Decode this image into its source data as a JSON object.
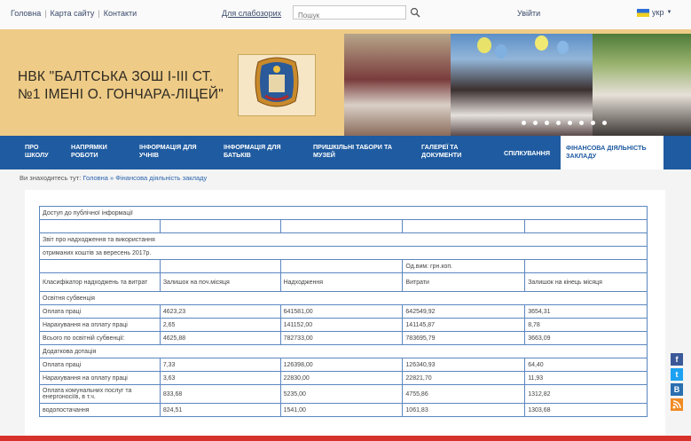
{
  "topbar": {
    "links": [
      "Головна",
      "Карта сайту",
      "Контакти"
    ],
    "vision_label": "Для слабозорих",
    "search_placeholder": "Пошук",
    "login_label": "Увійти",
    "lang_label": "укр"
  },
  "header": {
    "title": "НВК \"БАЛТСЬКА ЗОШ І-ІІІ СТ. №1 ІМЕНІ О. ГОНЧАРА-ЛІЦЕЙ\""
  },
  "nav": {
    "items": [
      "ПРО ШКОЛУ",
      "НАПРЯМКИ РОБОТИ",
      "ІНФОРМАЦІЯ ДЛЯ УЧНІВ",
      "ІНФОРМАЦІЯ ДЛЯ БАТЬКІВ",
      "ПРИШКІЛЬНІ ТАБОРИ ТА МУЗЕЙ",
      "ГАЛЕРЕЇ ТА ДОКУМЕНТИ",
      "СПІЛКУВАННЯ",
      "ФІНАНСОВА ДІЯЛЬНІСТЬ ЗАКЛАДУ"
    ],
    "active_index": 7
  },
  "breadcrumb": {
    "prefix": "Ви знаходитесь тут:",
    "home": "Головна",
    "separator": "»",
    "current": "Фінансова діяльність закладу"
  },
  "table": {
    "intro_rows": [
      "Доступ до публічної інформації",
      "Звіт про надходження та використання",
      "отриманих коштів за вересень 2017р."
    ],
    "units_note": "Од.вим: грн.коп.",
    "headers": [
      "Класифікатор надходжень та витрат",
      "Залишок на поч.місяця",
      "Надходження",
      "Витрати",
      "Залишок на кінець місяця"
    ],
    "rows": [
      {
        "section": "Освітня субвенція"
      },
      {
        "cells": [
          "Оплата праці",
          "4623,23",
          "641581,00",
          "642549,92",
          "3654,31"
        ]
      },
      {
        "cells": [
          "Нарахування на оплату праці",
          "2,65",
          "141152,00",
          "141145,87",
          "8,78"
        ]
      },
      {
        "cells": [
          "Всього по освітній субвенції:",
          "4625,88",
          "782733,00",
          "783695,79",
          "3663,09"
        ]
      },
      {
        "section": "Додаткова дотація"
      },
      {
        "cells": [
          "Оплата праці",
          "7,33",
          "126398,00",
          "126340,93",
          "64,40"
        ]
      },
      {
        "cells": [
          "Нарахування на оплату праці",
          "3,63",
          "22830,00",
          "22821,70",
          "11,93"
        ]
      },
      {
        "cells": [
          "Оплата комунальних послуг та енергоносіїв, в т.ч.",
          "833,68",
          "5235,00",
          "4755,86",
          "1312,82"
        ],
        "tall": true
      },
      {
        "cells": [
          "водопостачання",
          "824,51",
          "1541,00",
          "1061,83",
          "1303,68"
        ]
      }
    ]
  },
  "social": [
    "f",
    "t",
    "B",
    "rss"
  ]
}
